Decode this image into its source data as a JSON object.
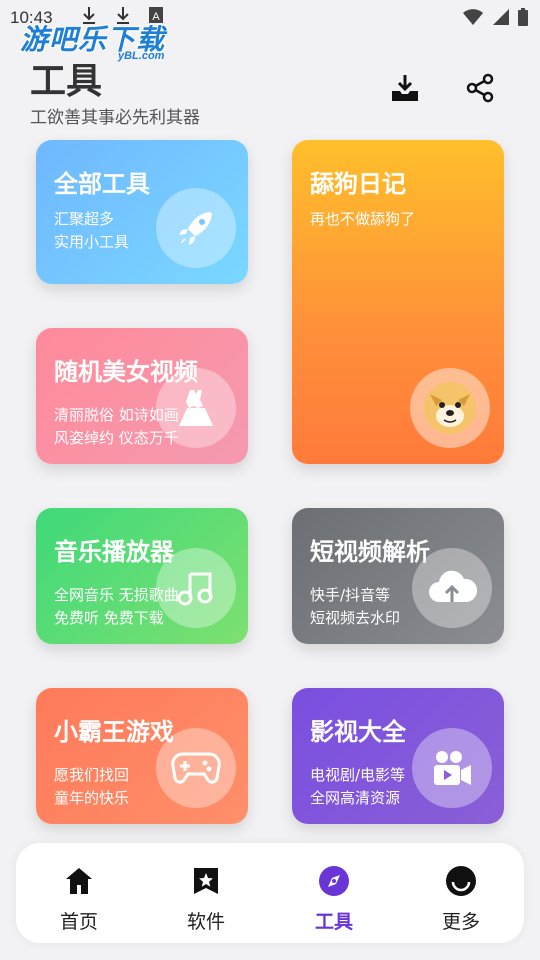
{
  "status_bar": {
    "time": "10:43"
  },
  "watermark": {
    "main": "游吧乐下载",
    "sub": "yBL.com"
  },
  "header": {
    "title": "工具",
    "subtitle": "工欲善其事必先利其器",
    "download_icon": "download-tray-icon",
    "share_icon": "share-icon"
  },
  "cards": [
    {
      "id": "all-tools",
      "title": "全部工具",
      "desc1": "汇聚超多",
      "desc2": "实用小工具",
      "icon": "rocket-icon"
    },
    {
      "id": "diary",
      "title": "舔狗日记",
      "desc1": "再也不做舔狗了",
      "desc2": "",
      "icon": "doge-icon"
    },
    {
      "id": "beauty-video",
      "title": "随机美女视频",
      "desc1": "清丽脱俗 如诗如画",
      "desc2": "风姿绰约 仪态万千",
      "icon": "dress-icon"
    },
    {
      "id": "music",
      "title": "音乐播放器",
      "desc1": "全网音乐 无损歌曲",
      "desc2": "免费听 免费下载",
      "icon": "music-note-icon"
    },
    {
      "id": "short-video",
      "title": "短视频解析",
      "desc1": "快手/抖音等",
      "desc2": "短视频去水印",
      "icon": "cloud-upload-icon"
    },
    {
      "id": "game",
      "title": "小霸王游戏",
      "desc1": "愿我们找回",
      "desc2": "童年的快乐",
      "icon": "gamepad-icon"
    },
    {
      "id": "movies",
      "title": "影视大全",
      "desc1": "电视剧/电影等",
      "desc2": "全网高清资源",
      "icon": "video-camera-icon"
    }
  ],
  "tabs": [
    {
      "label": "首页",
      "icon": "home-icon"
    },
    {
      "label": "软件",
      "icon": "bookmark-star-icon"
    },
    {
      "label": "工具",
      "icon": "compass-icon",
      "active": true
    },
    {
      "label": "更多",
      "icon": "smile-face-icon"
    }
  ],
  "colors": {
    "accent": "#6a35d6"
  }
}
